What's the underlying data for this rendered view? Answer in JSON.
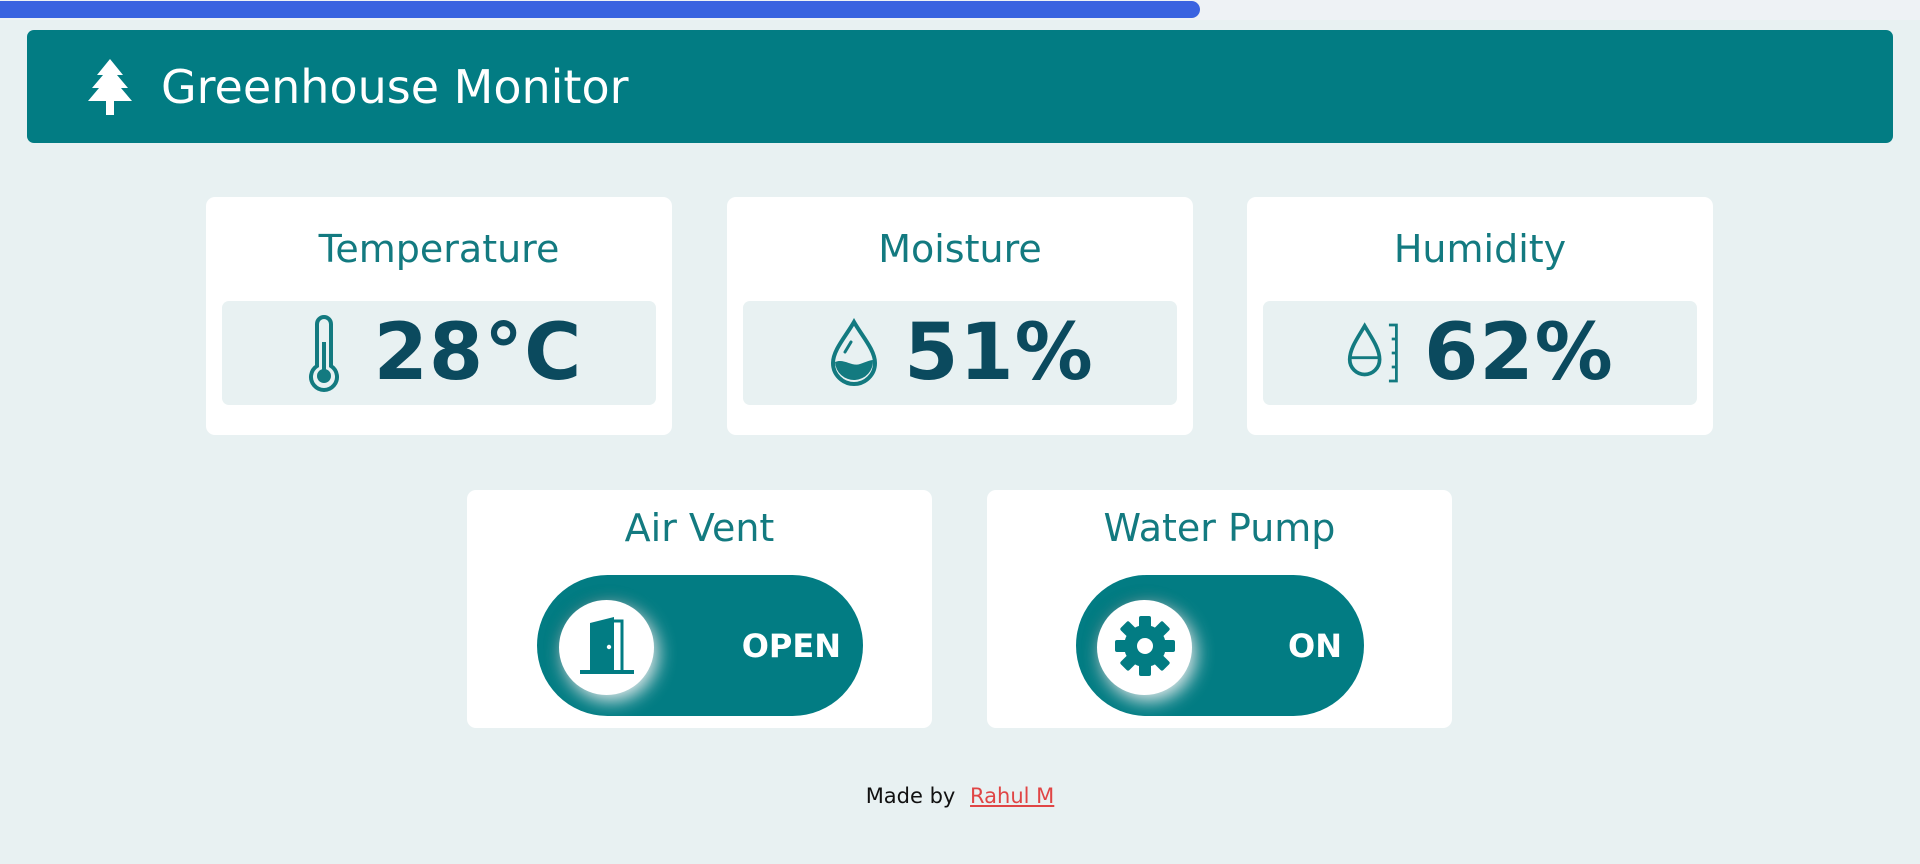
{
  "page_load": {
    "progress": 0.625
  },
  "header": {
    "icon": "tree-icon",
    "title": "Greenhouse Monitor"
  },
  "sensors": [
    {
      "title": "Temperature",
      "icon": "thermometer-icon",
      "value": "28°C"
    },
    {
      "title": "Moisture",
      "icon": "droplet-half-icon",
      "value": "51%"
    },
    {
      "title": "Humidity",
      "icon": "moisture-gauge-icon",
      "value": "62%"
    }
  ],
  "controls": [
    {
      "title": "Air Vent",
      "icon": "door-open-icon",
      "state_label": "OPEN",
      "on": true
    },
    {
      "title": "Water Pump",
      "icon": "gear-icon",
      "state_label": "ON",
      "on": true
    }
  ],
  "footer": {
    "made_by_text": "Made by",
    "author": "Rahul M"
  },
  "colors": {
    "accent": "#027c83",
    "value_text": "#0b4a5e",
    "background": "#e8f1f2",
    "link": "#e04545",
    "loading_bar": "#3a63e0"
  }
}
